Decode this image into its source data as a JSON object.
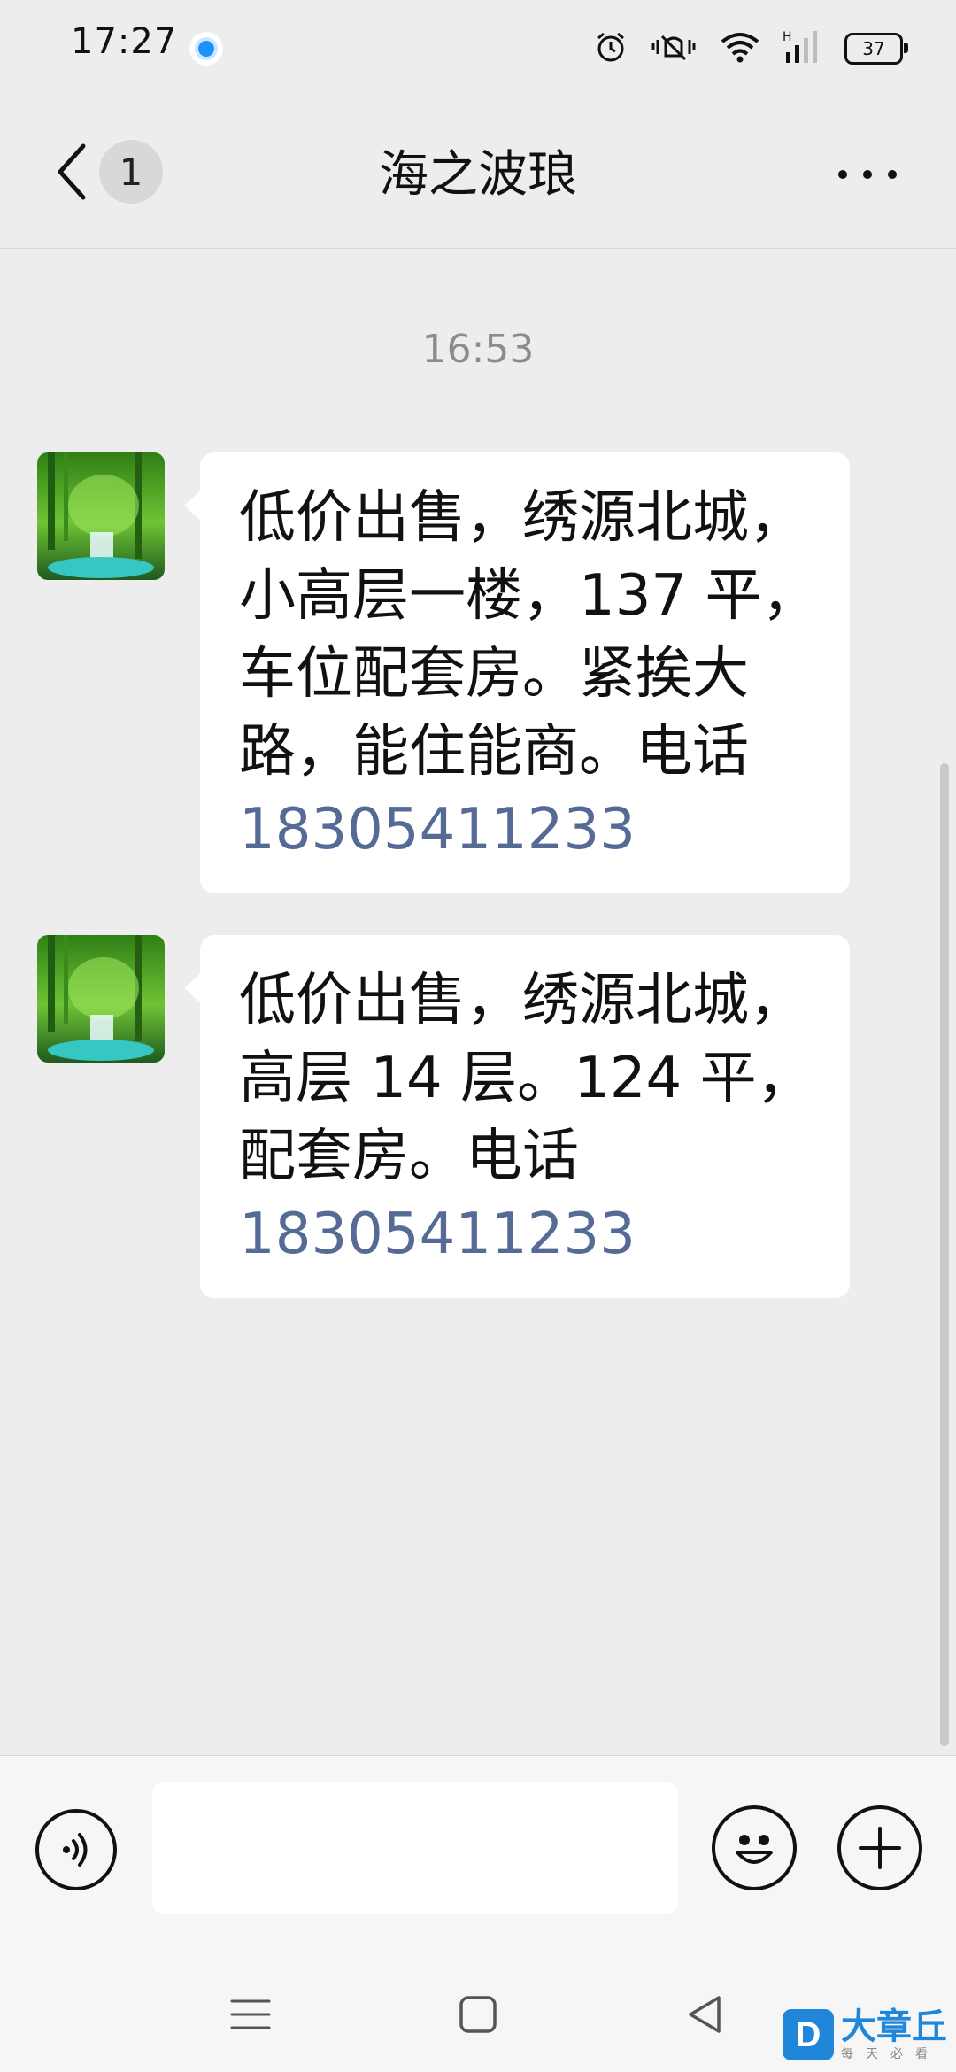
{
  "status_bar": {
    "time": "17:27",
    "battery": "37",
    "icons": [
      "alarm-icon",
      "mute-icon",
      "wifi-icon",
      "signal-icon"
    ]
  },
  "header": {
    "unread_count": "1",
    "title": "海之波琅"
  },
  "messages": {
    "timestamp": "16:53",
    "items": [
      {
        "text": "低价出售，绣源北城，小高层一楼，137 平，车位配套房。紧挨大路，能住能商。电话",
        "phone": "18305411233"
      },
      {
        "text": "低价出售，绣源北城，高层 14 层。124 平，配套房。电话",
        "phone": "18305411233"
      }
    ]
  },
  "input": {
    "value": ""
  },
  "watermark": {
    "title": "大章丘",
    "subtitle": "每天必看"
  },
  "colors": {
    "background": "#ededed",
    "bubble": "#ffffff",
    "link": "#556b96",
    "watermark": "#1f86d9"
  }
}
